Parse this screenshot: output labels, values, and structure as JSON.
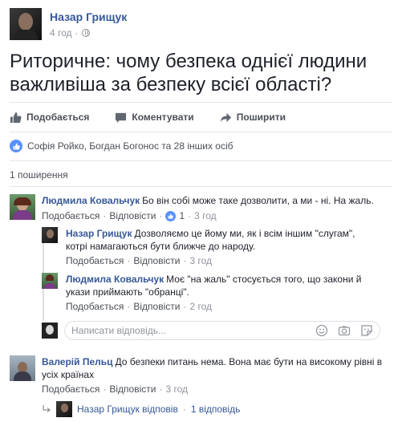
{
  "post": {
    "author": "Назар Грищук",
    "time": "4 год",
    "dot": "·",
    "text": "Риторичне: чому безпека однієї людини важливіша за безпеку всієї області?"
  },
  "actions": {
    "like": "Подобається",
    "comment": "Коментувати",
    "share": "Поширити"
  },
  "reactions": {
    "names": "Софія Ройко, Богдан Богонос та 28 інших осіб"
  },
  "shares": "1 поширення",
  "comments": [
    {
      "author": "Людмила Ковальчук",
      "text": "Бо він собі може таке дозволити, а ми - ні. На жаль.",
      "like": "Подобається",
      "reply": "Відповісти",
      "likes": "1",
      "time": "3 год",
      "replies": [
        {
          "author": "Назар Грищук",
          "text": "Дозволяємо це йому ми, як і всім іншим \"слугам\", котрі намагаються бути ближче до народу.",
          "like": "Подобається",
          "reply": "Відповісти",
          "time": "3 год"
        },
        {
          "author": "Людмила Ковальчук",
          "text": "Моє \"на жаль\" стосується того, що закони й укази приймають \"обранці\".",
          "like": "Подобається",
          "reply": "Відповісти",
          "time": "2 год"
        }
      ],
      "reply_placeholder": "Написати відповідь..."
    },
    {
      "author": "Валерій Пельц",
      "text": "До безпеки питань нема. Вона має бути на високому рівні в усіх країнах",
      "like": "Подобається",
      "reply": "Відповісти",
      "time": "3 год",
      "replied_by": "Назар Грищук відповів",
      "reply_count": "1 відповідь"
    }
  ],
  "colors": {
    "link": "#365899",
    "secondary": "#90949c",
    "action": "#4b4f56",
    "like_blue": "#5890ff"
  }
}
